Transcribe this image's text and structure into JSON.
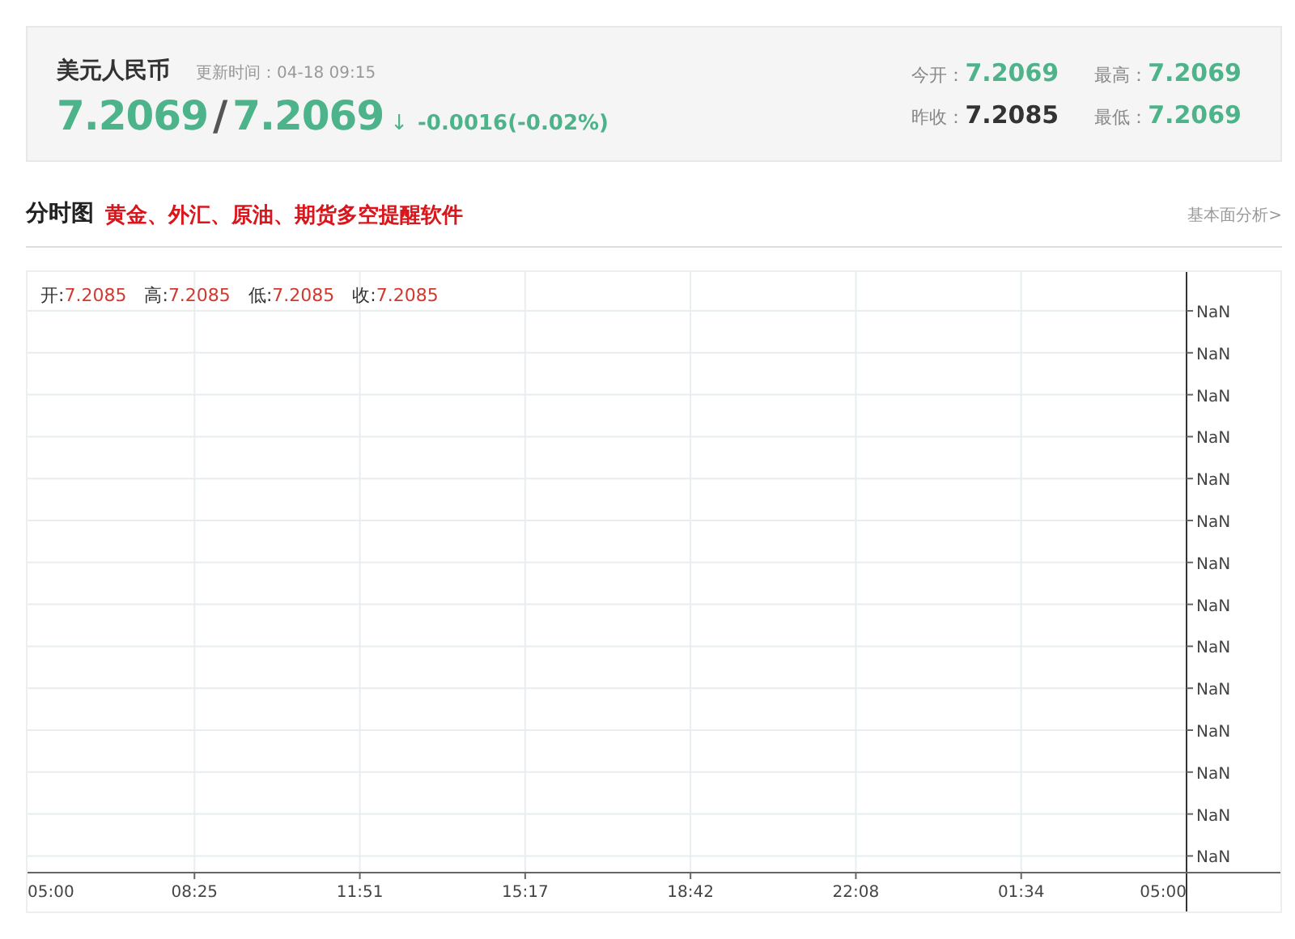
{
  "quote": {
    "title": "美元人民币",
    "update_time": "更新时间：04-18 09:15",
    "price_a": "7.2069",
    "separator": "/",
    "price_b": "7.2069",
    "arrow": "↓",
    "change": "-0.0016(-0.02%)",
    "color": "#4db38a",
    "stats": [
      {
        "label": "今开：",
        "value": "7.2069",
        "color": "#4db38a"
      },
      {
        "label": "最高：",
        "value": "7.2069",
        "color": "#4db38a"
      },
      {
        "label": "昨收：",
        "value": "7.2085",
        "color": "#333333"
      },
      {
        "label": "最低：",
        "value": "7.2069",
        "color": "#4db38a"
      }
    ]
  },
  "section": {
    "title": "分时图",
    "promo_link": "黄金、外汇、原油、期货多空提醒软件",
    "side_link": "基本面分析>"
  },
  "chart": {
    "legend": [
      {
        "label": "开:",
        "value": "7.2085"
      },
      {
        "label": "高:",
        "value": "7.2085"
      },
      {
        "label": "低:",
        "value": "7.2085"
      },
      {
        "label": "收:",
        "value": "7.2085"
      }
    ],
    "y_labels": [
      "NaN",
      "NaN",
      "NaN",
      "NaN",
      "NaN",
      "NaN",
      "NaN",
      "NaN",
      "NaN",
      "NaN",
      "NaN",
      "NaN",
      "NaN",
      "NaN"
    ],
    "x_labels": [
      "05:00",
      "08:25",
      "11:51",
      "15:17",
      "18:42",
      "22:08",
      "01:34",
      "05:00"
    ]
  }
}
